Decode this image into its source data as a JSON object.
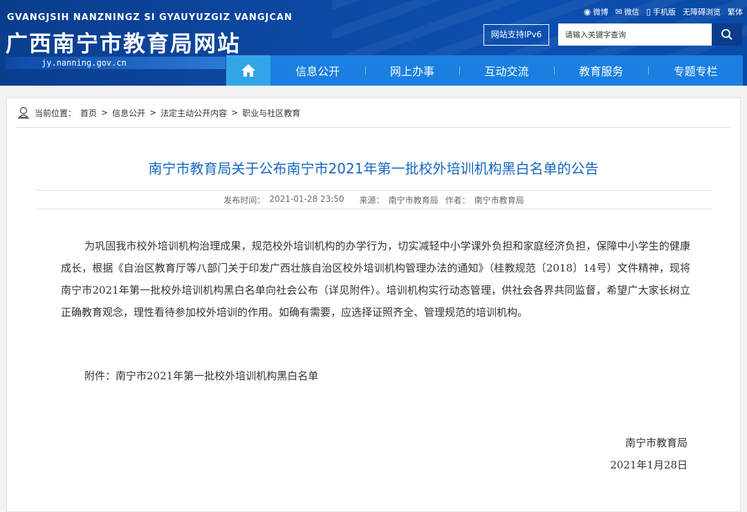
{
  "header": {
    "pinyin": "GVANGJSIH NANZNINGZ SI GYAUYUZGIZ VANGJCAN",
    "title": "广西南宁市教育局网站",
    "domain": "jy.nanning.gov.cn",
    "toplinks": [
      "微博",
      "微信",
      "手机版",
      "无障碍浏览",
      "繁体"
    ],
    "ipv6": "网站支持IPv6",
    "search_placeholder": "请输入关键字查询"
  },
  "nav": {
    "items": [
      "信息公开",
      "网上办事",
      "互动交流",
      "教育服务",
      "专题专栏"
    ]
  },
  "breadcrumb": {
    "label": "当前位置：",
    "path": [
      "首页",
      "信息公开",
      "法定主动公开内容",
      "职业与社区教育"
    ]
  },
  "article": {
    "title": "南宁市教育局关于公布南宁市2021年第一批校外培训机构黑白名单的公告",
    "publish_label": "发布时间：",
    "publish_time": "2021-01-28 23:50",
    "source_label": "来源：",
    "source": "南宁市教育局",
    "author_label": "作者：",
    "author": "南宁市教育局",
    "body": "为巩固我市校外培训机构治理成果，规范校外培训机构的办学行为，切实减轻中小学课外负担和家庭经济负担，保障中小学生的健康成长，根据《自治区教育厅等八部门关于印发广西壮族自治区校外培训机构管理办法的通知》（桂教规范〔2018〕14号）文件精神，现将南宁市2021年第一批校外培训机构黑白名单向社会公布（详见附件）。培训机构实行动态管理，供社会各界共同监督，希望广大家长树立正确教育观念，理性看待参加校外培训的作用。如确有需要，应选择证照齐全、管理规范的培训机构。",
    "attachment_label": "附件：",
    "attachment": "南宁市2021年第一批校外培训机构黑白名单",
    "signature": "南宁市教育局",
    "date": "2021年1月28日"
  }
}
